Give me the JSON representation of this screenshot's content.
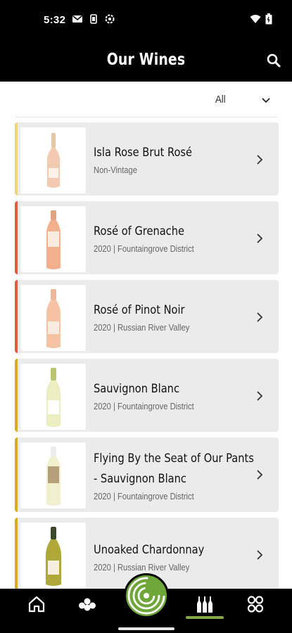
{
  "status_bar": {
    "time": "5:32",
    "left_icons": [
      "gmail-icon",
      "battery-saver-icon",
      "settings-icon"
    ],
    "right_icons": [
      "wifi-icon",
      "battery-icon"
    ]
  },
  "header": {
    "title": "Our Wines",
    "search_icon": "search-icon"
  },
  "filter": {
    "value": "All",
    "icon": "chevron-down-icon"
  },
  "wines": [
    {
      "name": "Isla Rose Brut Rosé",
      "subtitle": "Non-Vintage",
      "category_color": "#f2d580",
      "bottle": "rose"
    },
    {
      "name": "Rosé of Grenache",
      "subtitle": "2020 | Fountaingrove District",
      "category_color": "#e35a3c",
      "bottle": "rose"
    },
    {
      "name": "Rosé of Pinot Noir",
      "subtitle": "2020 | Russian River Valley",
      "category_color": "#e35a3c",
      "bottle": "rose"
    },
    {
      "name": "Sauvignon Blanc",
      "subtitle": "2020 | Fountaingrove District",
      "category_color": "#d9ab1e",
      "bottle": "white"
    },
    {
      "name": "Flying By the Seat of Our Pants - Sauvignon Blanc",
      "name_line1": "Flying By the Seat of Our Pants",
      "name_line2": "- Sauvignon Blanc",
      "subtitle": "2020 | Fountaingrove District",
      "category_color": "#d9ab1e",
      "bottle": "white"
    },
    {
      "name": "Unoaked Chardonnay",
      "subtitle": "2020 | Russian River Valley",
      "category_color": "#d9ab1e",
      "bottle": "green"
    }
  ],
  "bottom_nav": {
    "items": [
      "home-icon",
      "community-icon",
      "target-icon",
      "wines-icon",
      "grid-icon"
    ],
    "active": "wines-icon",
    "accent": "#6ea63a"
  }
}
